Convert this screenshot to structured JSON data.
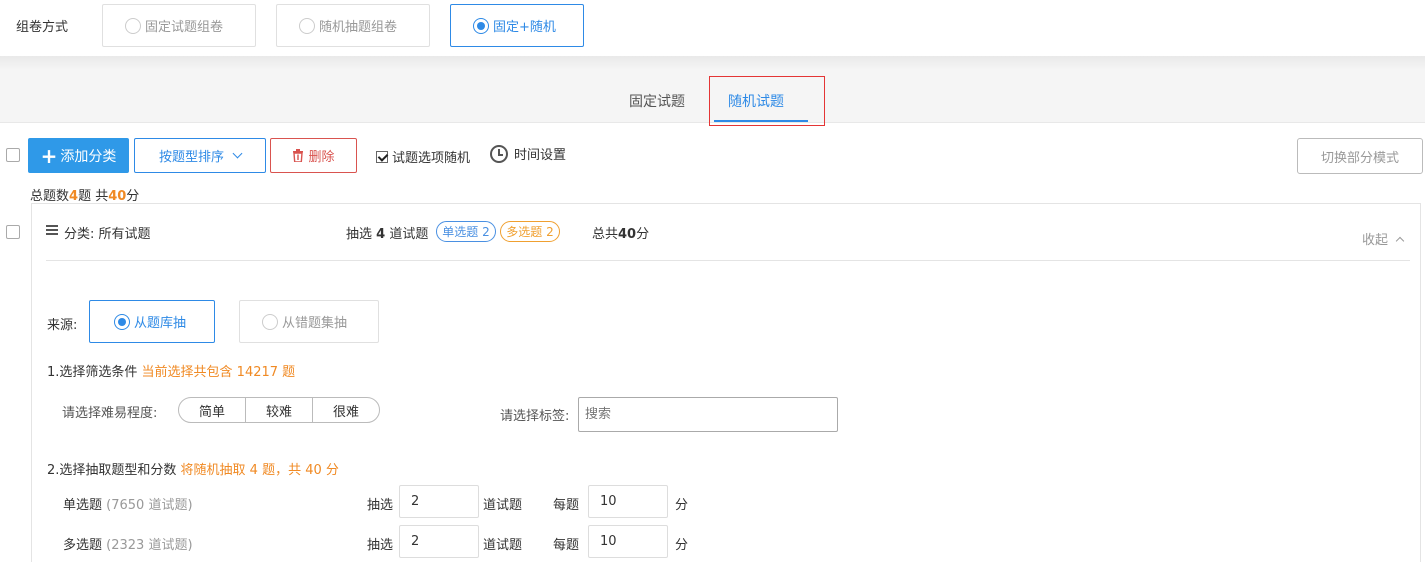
{
  "mode": {
    "label": "组卷方式",
    "options": [
      {
        "label": "固定试题组卷",
        "selected": false
      },
      {
        "label": "随机抽题组卷",
        "selected": false
      },
      {
        "label": "固定+随机",
        "selected": true
      }
    ]
  },
  "tabs": [
    {
      "label": "固定试题",
      "active": false
    },
    {
      "label": "随机试题",
      "active": true
    }
  ],
  "toolbar": {
    "add_label": "添加分类",
    "sort_label": "按题型排序",
    "delete_label": "删除",
    "random_options_label": "试题选项随机",
    "random_options_checked": true,
    "time_settings_label": "时间设置",
    "switch_mode_label": "切换部分模式"
  },
  "summary": {
    "prefix": "总题数",
    "count": "4",
    "mid": "题 共",
    "score": "40",
    "suffix": "分"
  },
  "category": {
    "title": "分类: 所有试题",
    "pick_prefix": "抽选",
    "pick_count": "4",
    "pick_suffix": "道试题",
    "tag_single": "单选题 2",
    "tag_multi": "多选题 2",
    "total_prefix": "总共",
    "total_score": "40",
    "total_suffix": "分",
    "collapse_label": "收起"
  },
  "source": {
    "label": "来源:",
    "options": [
      {
        "label": "从题库抽",
        "selected": true
      },
      {
        "label": "从错题集抽",
        "selected": false
      }
    ]
  },
  "filter": {
    "step_title": "1.选择筛选条件",
    "step_note": "当前选择共包含 14217 题",
    "difficulty_label": "请选择难易程度:",
    "difficulty_options": [
      "简单",
      "较难",
      "很难"
    ],
    "tag_label": "请选择标签:",
    "tag_placeholder": "搜索"
  },
  "extract": {
    "step_title": "2.选择抽取题型和分数",
    "step_note": "将随机抽取 4 题，共 40 分",
    "rows": [
      {
        "type": "单选题",
        "available": "(7650 道试题)",
        "pick_label": "抽选",
        "count": "2",
        "unit": "道试题",
        "per_label": "每题",
        "score": "10",
        "score_unit": "分"
      },
      {
        "type": "多选题",
        "available": "(2323 道试题)",
        "pick_label": "抽选",
        "count": "2",
        "unit": "道试题",
        "per_label": "每题",
        "score": "10",
        "score_unit": "分"
      }
    ]
  }
}
